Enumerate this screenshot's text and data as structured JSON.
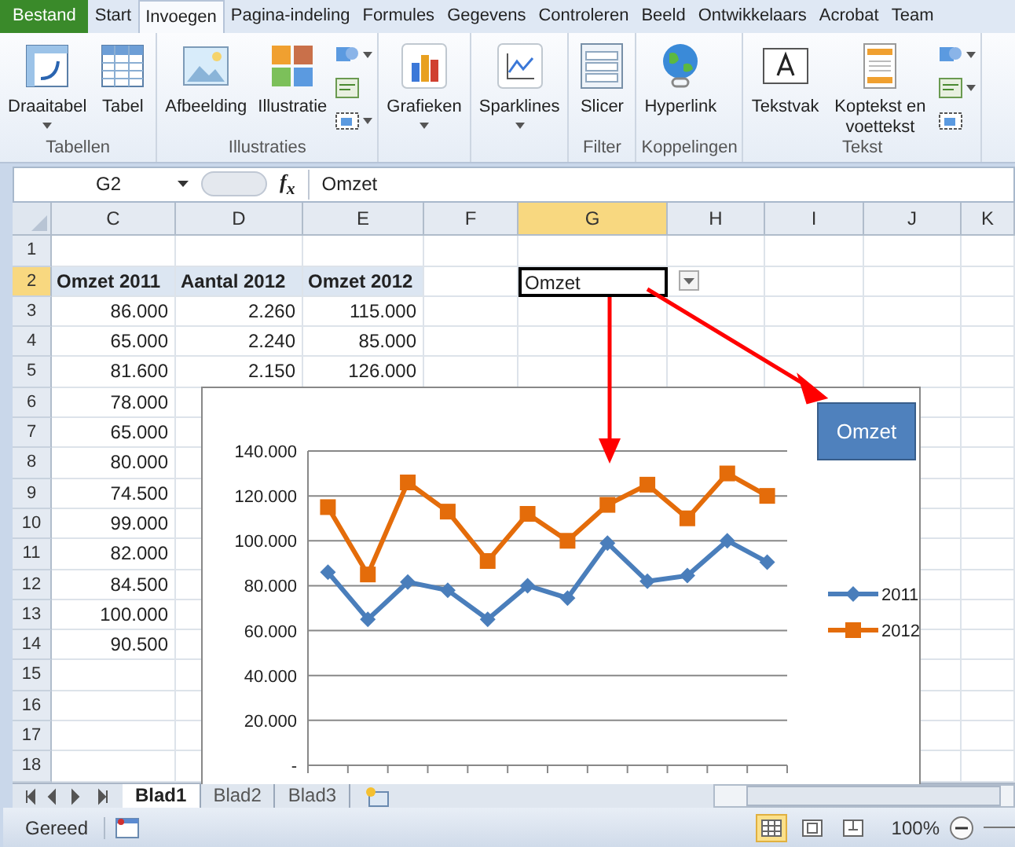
{
  "ribbon_tabs": [
    {
      "label": "Bestand",
      "kind": "file",
      "selected": false
    },
    {
      "label": "Start",
      "kind": "tab",
      "selected": false
    },
    {
      "label": "Invoegen",
      "kind": "tab",
      "selected": true
    },
    {
      "label": "Pagina-indeling",
      "kind": "tab",
      "selected": false
    },
    {
      "label": "Formules",
      "kind": "tab",
      "selected": false
    },
    {
      "label": "Gegevens",
      "kind": "tab",
      "selected": false
    },
    {
      "label": "Controleren",
      "kind": "tab",
      "selected": false
    },
    {
      "label": "Beeld",
      "kind": "tab",
      "selected": false
    },
    {
      "label": "Ontwikkelaars",
      "kind": "tab",
      "selected": false
    },
    {
      "label": "Acrobat",
      "kind": "tab",
      "selected": false
    },
    {
      "label": "Team",
      "kind": "tab",
      "selected": false
    }
  ],
  "ribbon_groups": [
    {
      "label": "Tabellen",
      "buttons": [
        {
          "label": "Draaitabel",
          "dropdown": true
        },
        {
          "label": "Tabel",
          "dropdown": false
        }
      ]
    },
    {
      "label": "Illustraties",
      "buttons": [
        {
          "label": "Afbeelding",
          "dropdown": false
        },
        {
          "label": "Illustratie",
          "dropdown": false
        }
      ],
      "small_buttons": [
        {
          "dropdown": true
        },
        {
          "dropdown": false
        },
        {
          "dropdown": true
        }
      ]
    },
    {
      "buttons": [
        {
          "label": "Grafieken",
          "dropdown": true
        }
      ]
    },
    {
      "buttons": [
        {
          "label": "Sparklines",
          "dropdown": true
        }
      ]
    },
    {
      "label": "Filter",
      "buttons": [
        {
          "label": "Slicer",
          "dropdown": false
        }
      ]
    },
    {
      "label": "Koppelingen",
      "buttons": [
        {
          "label": "Hyperlink",
          "dropdown": false
        }
      ]
    },
    {
      "label": "Tekst",
      "buttons": [
        {
          "label": "Tekstvak",
          "dropdown": false
        },
        {
          "label": "Koptekst en voettekst",
          "dropdown": false
        }
      ],
      "small_buttons": [
        {
          "dropdown": true
        },
        {
          "dropdown": true
        },
        {
          "dropdown": false
        }
      ]
    }
  ],
  "formula_bar": {
    "name_box": "G2",
    "fx": "f$_{x}$",
    "formula": "Omzet"
  },
  "columns": [
    {
      "label": "C",
      "selected": false
    },
    {
      "label": "D",
      "selected": false
    },
    {
      "label": "E",
      "selected": false
    },
    {
      "label": "F",
      "selected": false
    },
    {
      "label": "G",
      "selected": true
    },
    {
      "label": "H",
      "selected": false
    },
    {
      "label": "I",
      "selected": false
    },
    {
      "label": "J",
      "selected": false
    },
    {
      "label": "K",
      "selected": false
    }
  ],
  "rows": [
    {
      "number": "1",
      "selected": false
    },
    {
      "number": "2",
      "selected": true
    },
    {
      "number": "3",
      "selected": false
    },
    {
      "number": "4",
      "selected": false
    },
    {
      "number": "5",
      "selected": false
    },
    {
      "number": "6",
      "selected": false
    },
    {
      "number": "7",
      "selected": false
    },
    {
      "number": "8",
      "selected": false
    },
    {
      "number": "9",
      "selected": false
    },
    {
      "number": "10",
      "selected": false
    },
    {
      "number": "11",
      "selected": false
    },
    {
      "number": "12",
      "selected": false
    },
    {
      "number": "13",
      "selected": false
    },
    {
      "number": "14",
      "selected": false
    },
    {
      "number": "15",
      "selected": false
    },
    {
      "number": "16",
      "selected": false
    },
    {
      "number": "17",
      "selected": false
    },
    {
      "number": "18",
      "selected": false
    }
  ],
  "data_table": {
    "headers": [
      "Omzet 2011",
      "Aantal 2012",
      "Omzet 2012"
    ],
    "rows": [
      [
        "86.000",
        "2.260",
        "115.000"
      ],
      [
        "65.000",
        "2.240",
        "85.000"
      ],
      [
        "81.600",
        "2.150",
        "126.000"
      ],
      [
        "78.000"
      ],
      [
        "65.000"
      ],
      [
        "80.000"
      ],
      [
        "74.500"
      ],
      [
        "99.000"
      ],
      [
        "82.000"
      ],
      [
        "84.500"
      ],
      [
        "100.000"
      ],
      [
        "90.500"
      ]
    ]
  },
  "active_cell": {
    "text": "Omzet",
    "dropdown": true
  },
  "chart": {
    "chart_data": {
      "type": "line",
      "grid": true,
      "legend": true,
      "ylim": [
        0,
        140000
      ],
      "yticks": [
        {
          "value": 0,
          "label": "-"
        },
        {
          "value": 20000,
          "label": "20.000"
        },
        {
          "value": 40000,
          "label": "40.000"
        },
        {
          "value": 60000,
          "label": "60.000"
        },
        {
          "value": 80000,
          "label": "80.000"
        },
        {
          "value": 100000,
          "label": "100.000"
        },
        {
          "value": 120000,
          "label": "120.000"
        },
        {
          "value": 140000,
          "label": "140.000"
        }
      ],
      "series": [
        {
          "name": "2011",
          "color": "#4a7ebb",
          "marker": "diamond",
          "values": [
            86000,
            65000,
            81600,
            78000,
            65000,
            80000,
            74500,
            99000,
            82000,
            84500,
            100000,
            90500
          ]
        },
        {
          "name": "2012",
          "color": "#e46c0a",
          "marker": "square",
          "values": [
            115000,
            85000,
            126000,
            113000,
            91000,
            112000,
            100000,
            116000,
            125000,
            110000,
            130000,
            120000
          ]
        }
      ]
    }
  },
  "shape": {
    "label": "Omzet"
  },
  "sheet_tabs": [
    {
      "label": "Blad1",
      "selected": true
    },
    {
      "label": "Blad2",
      "selected": false
    },
    {
      "label": "Blad3",
      "selected": false
    }
  ],
  "status_bar": {
    "text": "Gereed",
    "views": [
      {
        "selected": true
      },
      {
        "selected": false
      },
      {
        "selected": false
      }
    ],
    "zoom": "100%"
  }
}
